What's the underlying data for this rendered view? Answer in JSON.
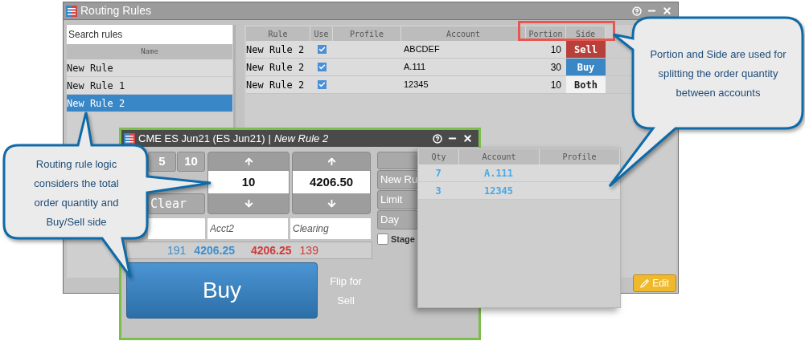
{
  "routing_window": {
    "title": "Routing Rules",
    "search": {
      "placeholder": "Search rules"
    },
    "rules_header": "Name",
    "rules": [
      {
        "name": "New Rule",
        "selected": false
      },
      {
        "name": "New Rule 1",
        "selected": false
      },
      {
        "name": "New Rule 2",
        "selected": true
      }
    ],
    "table": {
      "columns": [
        "Rule",
        "Use",
        "Profile",
        "Account",
        "Portion",
        "Side"
      ],
      "rows": [
        {
          "rule": "New Rule 2",
          "use": true,
          "account": "ABCDEF",
          "portion": "10",
          "side": {
            "label": "Sell",
            "kind": "sell"
          }
        },
        {
          "rule": "New Rule 2",
          "use": true,
          "account": "A.111",
          "portion": "30",
          "side": {
            "label": "Buy",
            "kind": "buy"
          }
        },
        {
          "rule": "New Rule 2",
          "use": true,
          "account": "12345",
          "portion": "10",
          "side": {
            "label": "Both",
            "kind": "both"
          }
        }
      ]
    },
    "edit_button": "Edit"
  },
  "order_window": {
    "title": "CME ES Jun21 (ES Jun21)",
    "separator": "|",
    "rule": "New Rule 2",
    "quantity_buttons": [
      "5",
      "10",
      "Clear"
    ],
    "quantity": "10",
    "price": "4206.50",
    "order_options": [
      "New Ru",
      "Limit",
      "Day"
    ],
    "stage": {
      "label": "Stage",
      "checked": false
    },
    "fields": [
      {
        "placeholder": "Acct2"
      },
      {
        "placeholder": "Clearing"
      }
    ],
    "market": {
      "bid_size": "191",
      "bid": "4206.25",
      "ask": "4206.25",
      "ask_size": "139"
    },
    "buy_button": "Buy",
    "flip_label": "Flip for Sell"
  },
  "allocation_popup": {
    "columns": [
      "Qty",
      "Account",
      "Profile"
    ],
    "rows": [
      {
        "qty": "7",
        "account": "A.111"
      },
      {
        "qty": "3",
        "account": "12345"
      }
    ]
  },
  "callouts": [
    {
      "text": "Routing rule logic considers the total order quantity and Buy/Sell side"
    },
    {
      "text": "Portion and Side are used for splitting the order quantity between accounts"
    }
  ]
}
